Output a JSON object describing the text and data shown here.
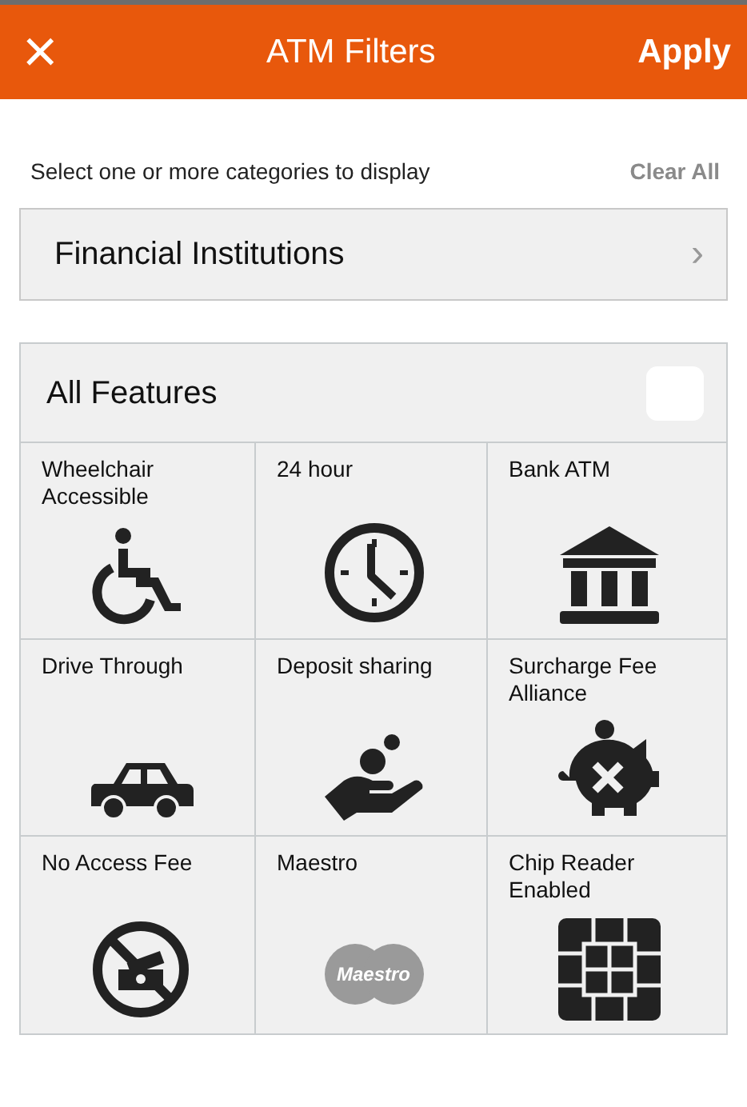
{
  "header": {
    "close": "×",
    "title": "ATM Filters",
    "action": "Apply"
  },
  "intro": {
    "text": "Select one or more categories to display",
    "clear": "Clear All"
  },
  "institutions": {
    "label": "Financial Institutions",
    "chevron": "›"
  },
  "all_features": {
    "label": "All Features",
    "checked": false
  },
  "features": [
    {
      "label": "Wheelchair Accessible"
    },
    {
      "label": "24 hour"
    },
    {
      "label": "Bank ATM"
    },
    {
      "label": "Drive Through"
    },
    {
      "label": "Deposit sharing"
    },
    {
      "label": "Surcharge Fee Alliance"
    },
    {
      "label": "No Access Fee"
    },
    {
      "label": "Maestro",
      "logo_text": "Maestro"
    },
    {
      "label": "Chip Reader Enabled"
    }
  ]
}
